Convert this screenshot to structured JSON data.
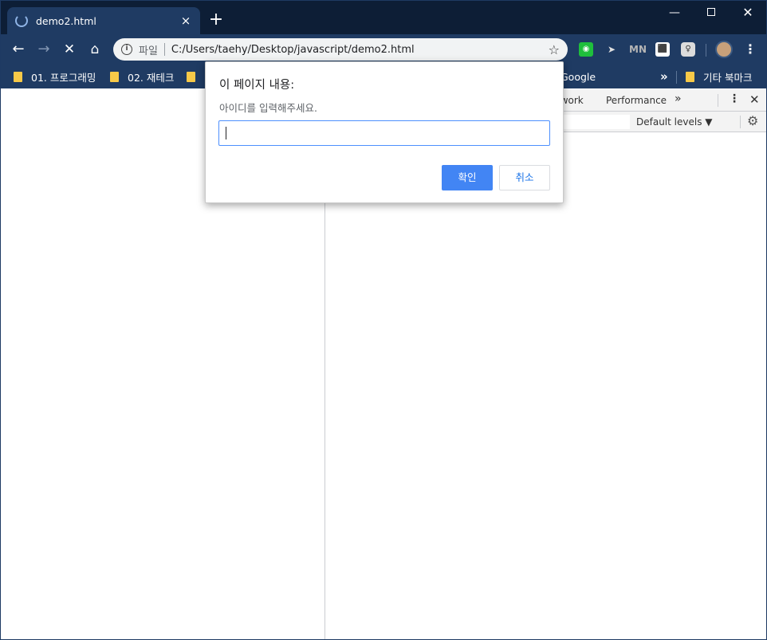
{
  "tab": {
    "title": "demo2.html",
    "close_icon": "×",
    "new_tab_icon": "+"
  },
  "window_controls": {
    "minimize": "—",
    "close": "✕"
  },
  "toolbar": {
    "back_icon": "←",
    "forward_icon": "→",
    "stop_icon": "✕",
    "home_icon": "⌂",
    "file_label": "파일",
    "url": "C:/Users/taehy/Desktop/javascript/demo2.html",
    "bookmark_star": "☆",
    "menu_icon": "⋮"
  },
  "extensions": [
    "green-camera-extension",
    "cursor-extension",
    "mn-extension",
    "blue-doc-extension",
    "bulb-extension"
  ],
  "bookmarks": {
    "items": [
      {
        "label": "01. 프로그래밍"
      },
      {
        "label": "02. 재테크"
      },
      {
        "label": ""
      }
    ],
    "google_label": "Google",
    "more_icon": "»",
    "other_label": "기타 북마크"
  },
  "devtools": {
    "tab_network": "twork",
    "tab_performance": "Performance",
    "more_tabs_icon": "»",
    "kebab_icon": "⋮",
    "close_icon": "✕",
    "levels_label": "Default levels ▼",
    "gear_icon": "⚙"
  },
  "dialog": {
    "title": "이 페이지 내용:",
    "message": "아이디를 입력해주세요.",
    "input_value": "",
    "ok_label": "확인",
    "cancel_label": "취소",
    "ok_color": "#4285f4"
  }
}
